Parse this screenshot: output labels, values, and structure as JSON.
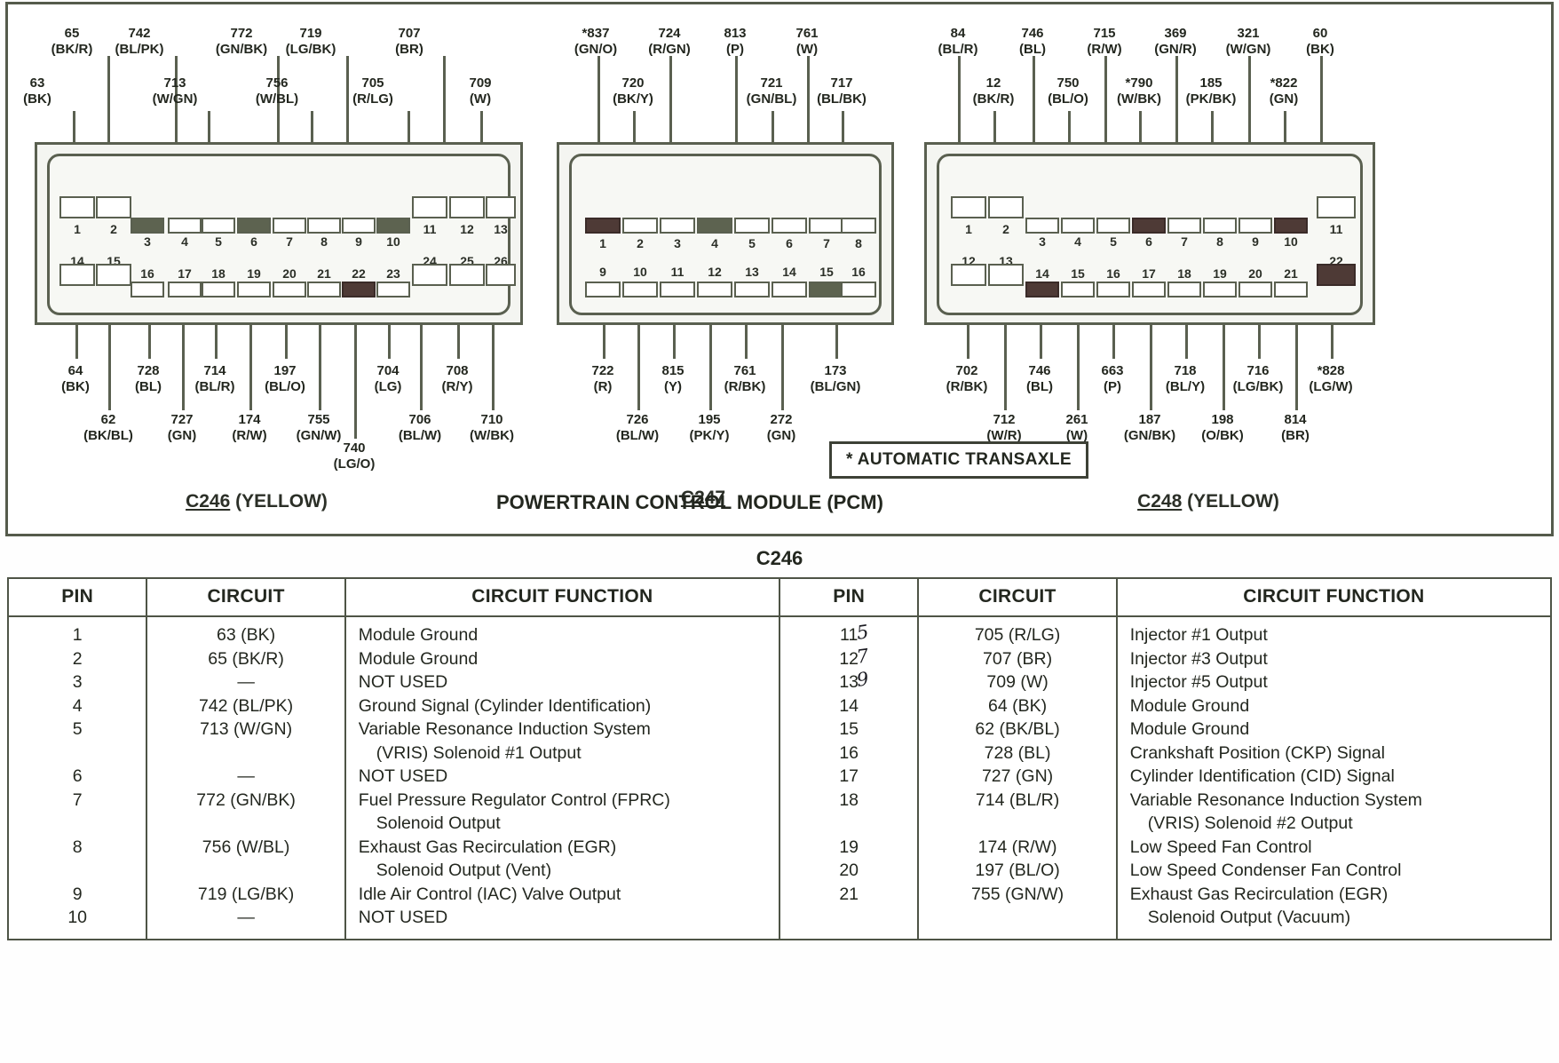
{
  "diagram": {
    "pcm_title": "POWERTRAIN CONTROL MODULE (PCM)",
    "transaxle_note": "* AUTOMATIC TRANSAXLE",
    "connectors": [
      {
        "id": "C246",
        "caption_name": "C246",
        "caption_color": " (YELLOW)",
        "top_labels_upper": [
          {
            "code": "65",
            "color": "(BK/R)"
          },
          {
            "code": "742",
            "color": "(BL/PK)"
          },
          {
            "code": "772",
            "color": "(GN/BK)"
          },
          {
            "code": "719",
            "color": "(LG/BK)"
          },
          {
            "code": "707",
            "color": "(BR)"
          }
        ],
        "top_labels_lower": [
          {
            "code": "63",
            "color": "(BK)"
          },
          {
            "code": "713",
            "color": "(W/GN)"
          },
          {
            "code": "756",
            "color": "(W/BL)"
          },
          {
            "code": "705",
            "color": "(R/LG)"
          },
          {
            "code": "709",
            "color": "(W)"
          }
        ],
        "bottom_labels_upper": [
          {
            "code": "64",
            "color": "(BK)"
          },
          {
            "code": "728",
            "color": "(BL)"
          },
          {
            "code": "714",
            "color": "(BL/R)"
          },
          {
            "code": "197",
            "color": "(BL/O)"
          },
          {
            "code": "704",
            "color": "(LG)"
          },
          {
            "code": "708",
            "color": "(R/Y)"
          }
        ],
        "bottom_labels_lower": [
          {
            "code": "62",
            "color": "(BK/BL)"
          },
          {
            "code": "727",
            "color": "(GN)"
          },
          {
            "code": "174",
            "color": "(R/W)"
          },
          {
            "code": "755",
            "color": "(GN/W)"
          },
          {
            "code": "706",
            "color": "(BL/W)"
          },
          {
            "code": "710",
            "color": "(W/BK)"
          }
        ],
        "bottom_labels_extra": [
          {
            "code": "740",
            "color": "(LG/O)"
          }
        ],
        "pins_top": [
          "1",
          "2",
          "3",
          "4",
          "5",
          "6",
          "7",
          "8",
          "9",
          "10",
          "11",
          "12",
          "13"
        ],
        "pins_bottom": [
          "14",
          "15",
          "16",
          "17",
          "18",
          "19",
          "20",
          "21",
          "22",
          "23",
          "24",
          "25",
          "26"
        ]
      },
      {
        "id": "C247",
        "caption_name": "C247",
        "caption_color": "",
        "top_labels_upper": [
          {
            "code": "*837",
            "color": "(GN/O)"
          },
          {
            "code": "724",
            "color": "(R/GN)"
          },
          {
            "code": "813",
            "color": "(P)"
          },
          {
            "code": "761",
            "color": "(W)"
          }
        ],
        "top_labels_lower": [
          {
            "code": "720",
            "color": "(BK/Y)"
          },
          {
            "code": "721",
            "color": "(GN/BL)"
          },
          {
            "code": "717",
            "color": "(BL/BK)"
          }
        ],
        "bottom_labels_upper": [
          {
            "code": "722",
            "color": "(R)"
          },
          {
            "code": "815",
            "color": "(Y)"
          },
          {
            "code": "761",
            "color": "(R/BK)"
          },
          {
            "code": "173",
            "color": "(BL/GN)"
          }
        ],
        "bottom_labels_lower": [
          {
            "code": "726",
            "color": "(BL/W)"
          },
          {
            "code": "195",
            "color": "(PK/Y)"
          },
          {
            "code": "272",
            "color": "(GN)"
          }
        ],
        "pins_top": [
          "1",
          "2",
          "3",
          "4",
          "5",
          "6",
          "7",
          "8"
        ],
        "pins_bottom": [
          "9",
          "10",
          "11",
          "12",
          "13",
          "14",
          "15",
          "16"
        ]
      },
      {
        "id": "C248",
        "caption_name": "C248",
        "caption_color": " (YELLOW)",
        "top_labels_upper": [
          {
            "code": "84",
            "color": "(BL/R)"
          },
          {
            "code": "746",
            "color": "(BL)"
          },
          {
            "code": "715",
            "color": "(R/W)"
          },
          {
            "code": "369",
            "color": "(GN/R)"
          },
          {
            "code": "321",
            "color": "(W/GN)"
          },
          {
            "code": "60",
            "color": "(BK)"
          }
        ],
        "top_labels_lower": [
          {
            "code": "12",
            "color": "(BK/R)"
          },
          {
            "code": "750",
            "color": "(BL/O)"
          },
          {
            "code": "*790",
            "color": "(W/BK)"
          },
          {
            "code": "185",
            "color": "(PK/BK)"
          },
          {
            "code": "*822",
            "color": "(GN)"
          }
        ],
        "bottom_labels_upper": [
          {
            "code": "702",
            "color": "(R/BK)"
          },
          {
            "code": "746",
            "color": "(BL)"
          },
          {
            "code": "663",
            "color": "(P)"
          },
          {
            "code": "718",
            "color": "(BL/Y)"
          },
          {
            "code": "716",
            "color": "(LG/BK)"
          },
          {
            "code": "*828",
            "color": "(LG/W)"
          }
        ],
        "bottom_labels_lower": [
          {
            "code": "712",
            "color": "(W/R)"
          },
          {
            "code": "261",
            "color": "(W)"
          },
          {
            "code": "187",
            "color": "(GN/BK)"
          },
          {
            "code": "198",
            "color": "(O/BK)"
          },
          {
            "code": "814",
            "color": "(BR)"
          }
        ],
        "pins_top": [
          "1",
          "2",
          "3",
          "4",
          "5",
          "6",
          "7",
          "8",
          "9",
          "10",
          "11"
        ],
        "pins_bottom": [
          "12",
          "13",
          "14",
          "15",
          "16",
          "17",
          "18",
          "19",
          "20",
          "21",
          "22"
        ]
      }
    ]
  },
  "table": {
    "title": "C246",
    "headers": {
      "pin": "PIN",
      "circuit": "CIRCUIT",
      "function": "CIRCUIT FUNCTION"
    },
    "left_rows": [
      {
        "pin": "1",
        "ink": "",
        "circuit": "63 (BK)",
        "function": [
          "Module Ground"
        ]
      },
      {
        "pin": "2",
        "ink": "",
        "circuit": "65 (BK/R)",
        "function": [
          "Module Ground"
        ]
      },
      {
        "pin": "3",
        "ink": "",
        "circuit": "—",
        "function": [
          "NOT USED"
        ]
      },
      {
        "pin": "4",
        "ink": "",
        "circuit": "742 (BL/PK)",
        "function": [
          "Ground Signal (Cylinder Identification)"
        ]
      },
      {
        "pin": "5",
        "ink": "",
        "circuit": "713 (W/GN)",
        "function": [
          "Variable Resonance Induction System",
          "(VRIS) Solenoid #1 Output"
        ]
      },
      {
        "pin": "6",
        "ink": "",
        "circuit": "—",
        "function": [
          "NOT USED"
        ]
      },
      {
        "pin": "7",
        "ink": "",
        "circuit": "772 (GN/BK)",
        "function": [
          "Fuel Pressure Regulator Control (FPRC)",
          "Solenoid Output"
        ]
      },
      {
        "pin": "8",
        "ink": "",
        "circuit": "756 (W/BL)",
        "function": [
          "Exhaust Gas Recirculation (EGR)",
          "Solenoid Output (Vent)"
        ]
      },
      {
        "pin": "9",
        "ink": "",
        "circuit": "719 (LG/BK)",
        "function": [
          "Idle Air Control (IAC) Valve Output"
        ]
      },
      {
        "pin": "10",
        "ink": "",
        "circuit": "—",
        "function": [
          "NOT USED"
        ]
      }
    ],
    "right_rows": [
      {
        "pin": "11",
        "ink": "5",
        "circuit": "705 (R/LG)",
        "function": [
          "Injector #1 Output"
        ]
      },
      {
        "pin": "12",
        "ink": "7",
        "circuit": "707 (BR)",
        "function": [
          "Injector #3 Output"
        ]
      },
      {
        "pin": "13",
        "ink": "9",
        "circuit": "709 (W)",
        "function": [
          "Injector #5 Output"
        ]
      },
      {
        "pin": "14",
        "ink": "",
        "circuit": "64 (BK)",
        "function": [
          "Module Ground"
        ]
      },
      {
        "pin": "15",
        "ink": "",
        "circuit": "62 (BK/BL)",
        "function": [
          "Module Ground"
        ]
      },
      {
        "pin": "16",
        "ink": "",
        "circuit": "728 (BL)",
        "function": [
          "Crankshaft Position (CKP) Signal"
        ]
      },
      {
        "pin": "17",
        "ink": "",
        "circuit": "727 (GN)",
        "function": [
          "Cylinder Identification (CID) Signal"
        ]
      },
      {
        "pin": "18",
        "ink": "",
        "circuit": "714 (BL/R)",
        "function": [
          "Variable Resonance Induction System",
          "(VRIS) Solenoid #2 Output"
        ]
      },
      {
        "pin": "19",
        "ink": "",
        "circuit": "174 (R/W)",
        "function": [
          "Low Speed Fan Control"
        ]
      },
      {
        "pin": "20",
        "ink": "",
        "circuit": "197 (BL/O)",
        "function": [
          "Low Speed Condenser Fan Control"
        ]
      },
      {
        "pin": "21",
        "ink": "",
        "circuit": "755 (GN/W)",
        "function": [
          "Exhaust Gas Recirculation  (EGR)",
          "Solenoid Output (Vacuum)"
        ]
      }
    ]
  },
  "colors": {
    "ink": "#4e3a36",
    "line": "#5a6050",
    "text": "#23271f"
  }
}
